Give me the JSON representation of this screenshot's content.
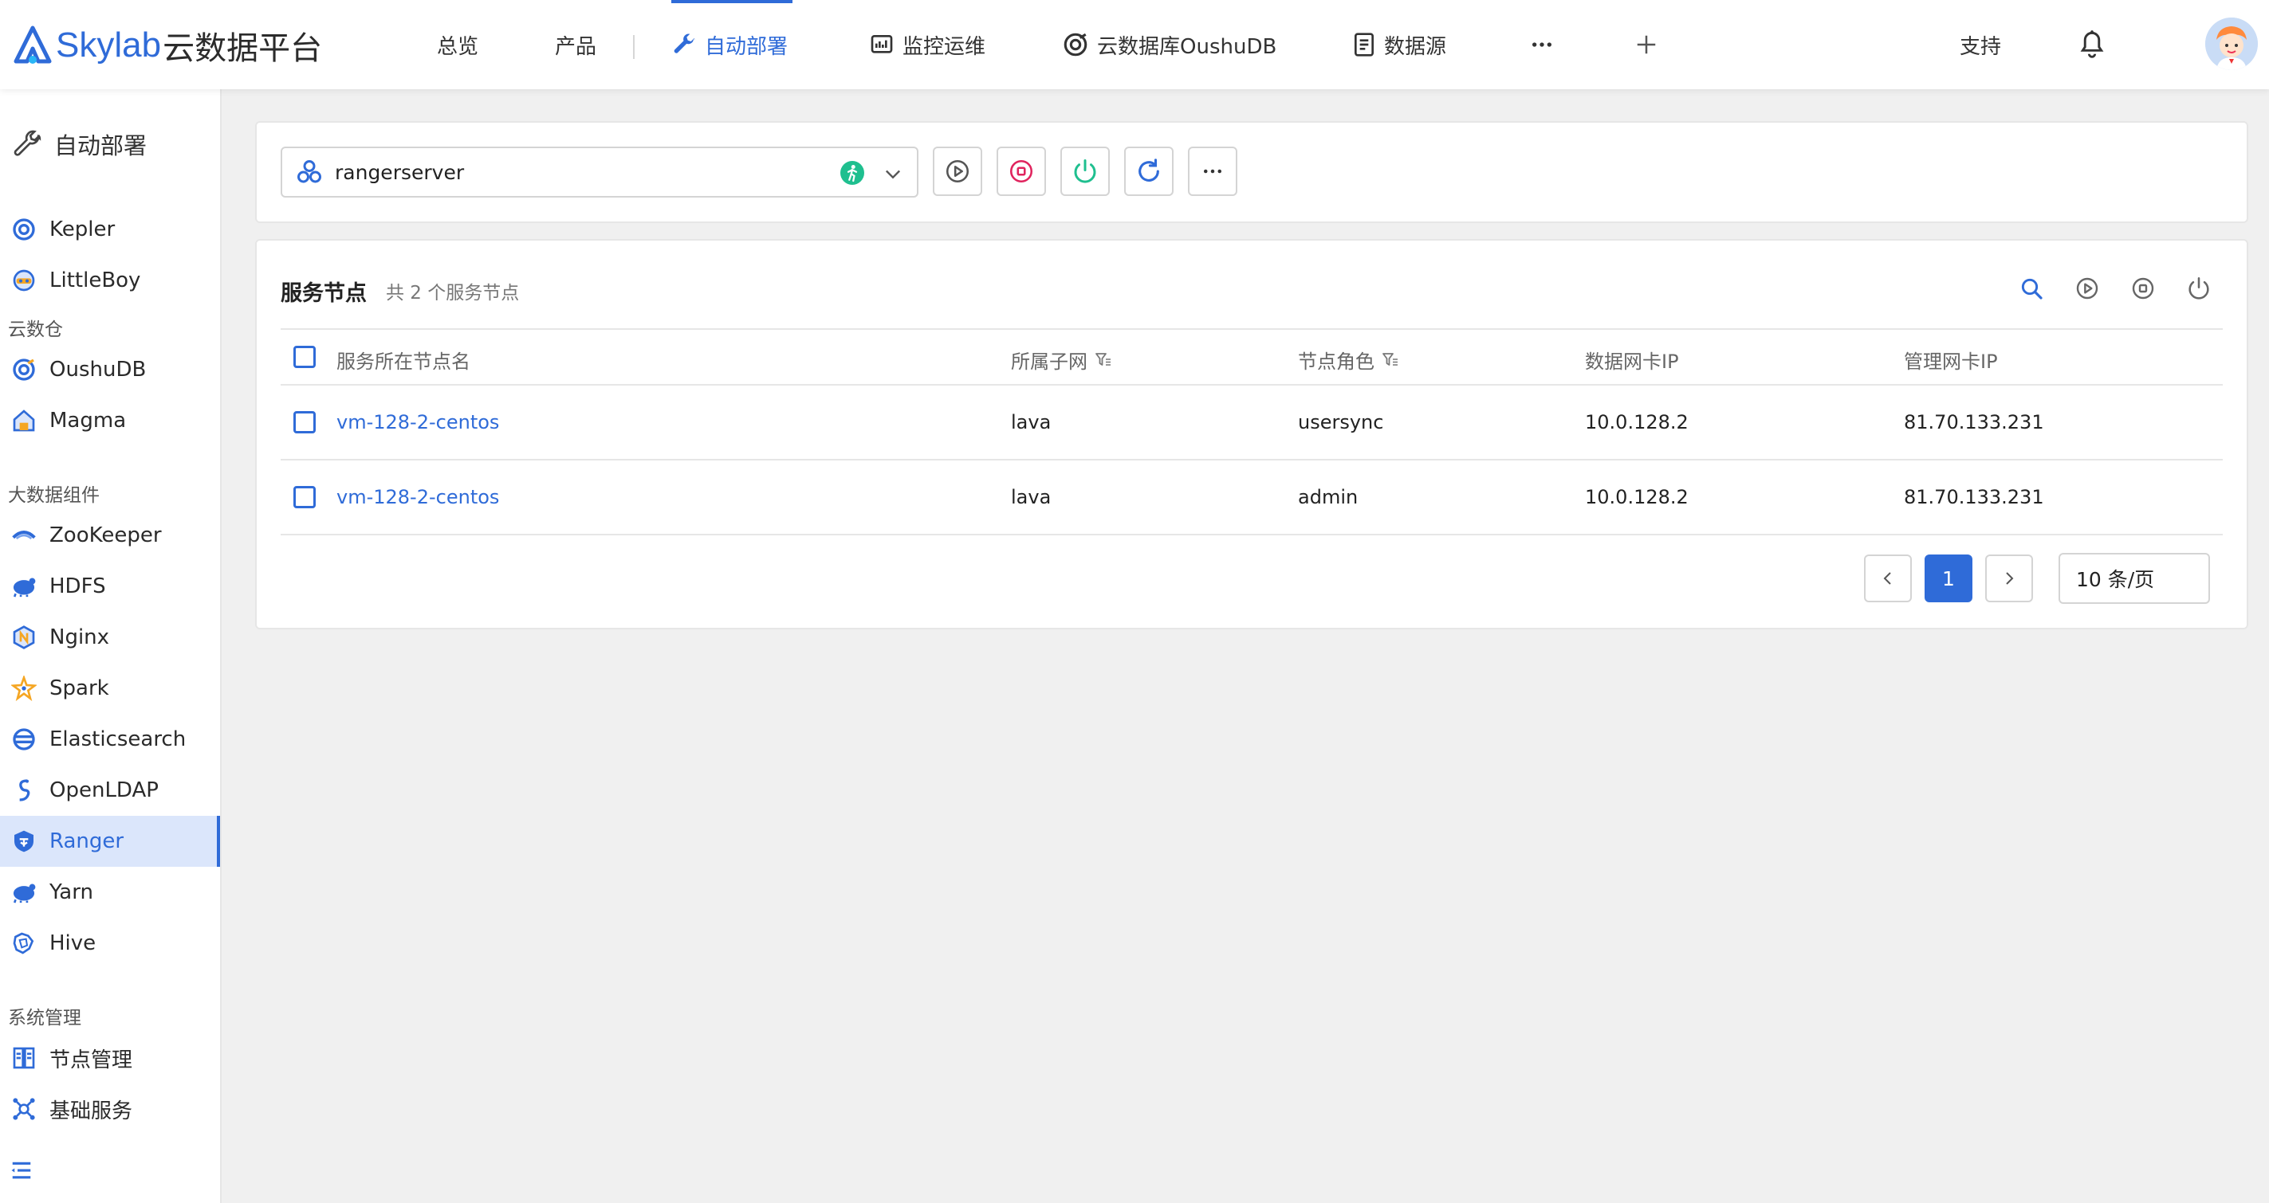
{
  "header": {
    "logo_text": "Skylab",
    "logo_cn": "云数据平台",
    "nav": [
      {
        "label": "总览"
      },
      {
        "label": "产品"
      },
      {
        "label": "自动部署",
        "icon": "wrench-icon",
        "active": true
      },
      {
        "label": "监控运维",
        "icon": "monitor-chart-icon"
      },
      {
        "label": "云数据库OushuDB",
        "icon": "oushudb-icon"
      },
      {
        "label": "数据源",
        "icon": "document-icon"
      }
    ],
    "support_label": "支持",
    "accent_color": "#2f6bd8"
  },
  "sidebar": {
    "title": "自动部署",
    "top_items": [
      {
        "label": "Kepler",
        "icon": "kepler-icon"
      },
      {
        "label": "LittleBoy",
        "icon": "littleboy-icon"
      }
    ],
    "groups": [
      {
        "label": "云数仓",
        "items": [
          {
            "label": "OushuDB",
            "icon": "oushudb-icon"
          },
          {
            "label": "Magma",
            "icon": "magma-icon"
          }
        ]
      },
      {
        "label": "大数据组件",
        "items": [
          {
            "label": "ZooKeeper",
            "icon": "zookeeper-icon"
          },
          {
            "label": "HDFS",
            "icon": "hdfs-icon"
          },
          {
            "label": "Nginx",
            "icon": "nginx-icon"
          },
          {
            "label": "Spark",
            "icon": "spark-icon"
          },
          {
            "label": "Elasticsearch",
            "icon": "elasticsearch-icon"
          },
          {
            "label": "OpenLDAP",
            "icon": "openldap-icon"
          },
          {
            "label": "Ranger",
            "icon": "ranger-icon",
            "active": true
          },
          {
            "label": "Yarn",
            "icon": "yarn-icon"
          },
          {
            "label": "Hive",
            "icon": "hive-icon"
          }
        ]
      },
      {
        "label": "系统管理",
        "items": [
          {
            "label": "节点管理",
            "icon": "node-manage-icon"
          },
          {
            "label": "基础服务",
            "icon": "base-service-icon"
          }
        ]
      }
    ]
  },
  "toolbar": {
    "selected_service": "rangerserver",
    "status_color": "#1fbf8f",
    "actions": [
      "play-icon",
      "stop-icon",
      "power-icon",
      "refresh-icon",
      "more-icon"
    ]
  },
  "panel": {
    "title": "服务节点",
    "subtitle": "共 2 个服务节点",
    "columns": [
      "服务所在节点名",
      "所属子网",
      "节点角色",
      "数据网卡IP",
      "管理网卡IP"
    ],
    "rows": [
      {
        "node": "vm-128-2-centos",
        "subnet": "lava",
        "role": "usersync",
        "data_ip": "10.0.128.2",
        "mgmt_ip": "81.70.133.231"
      },
      {
        "node": "vm-128-2-centos",
        "subnet": "lava",
        "role": "admin",
        "data_ip": "10.0.128.2",
        "mgmt_ip": "81.70.133.231"
      }
    ],
    "pagination": {
      "current_page": "1",
      "page_size": "10 条/页"
    }
  }
}
